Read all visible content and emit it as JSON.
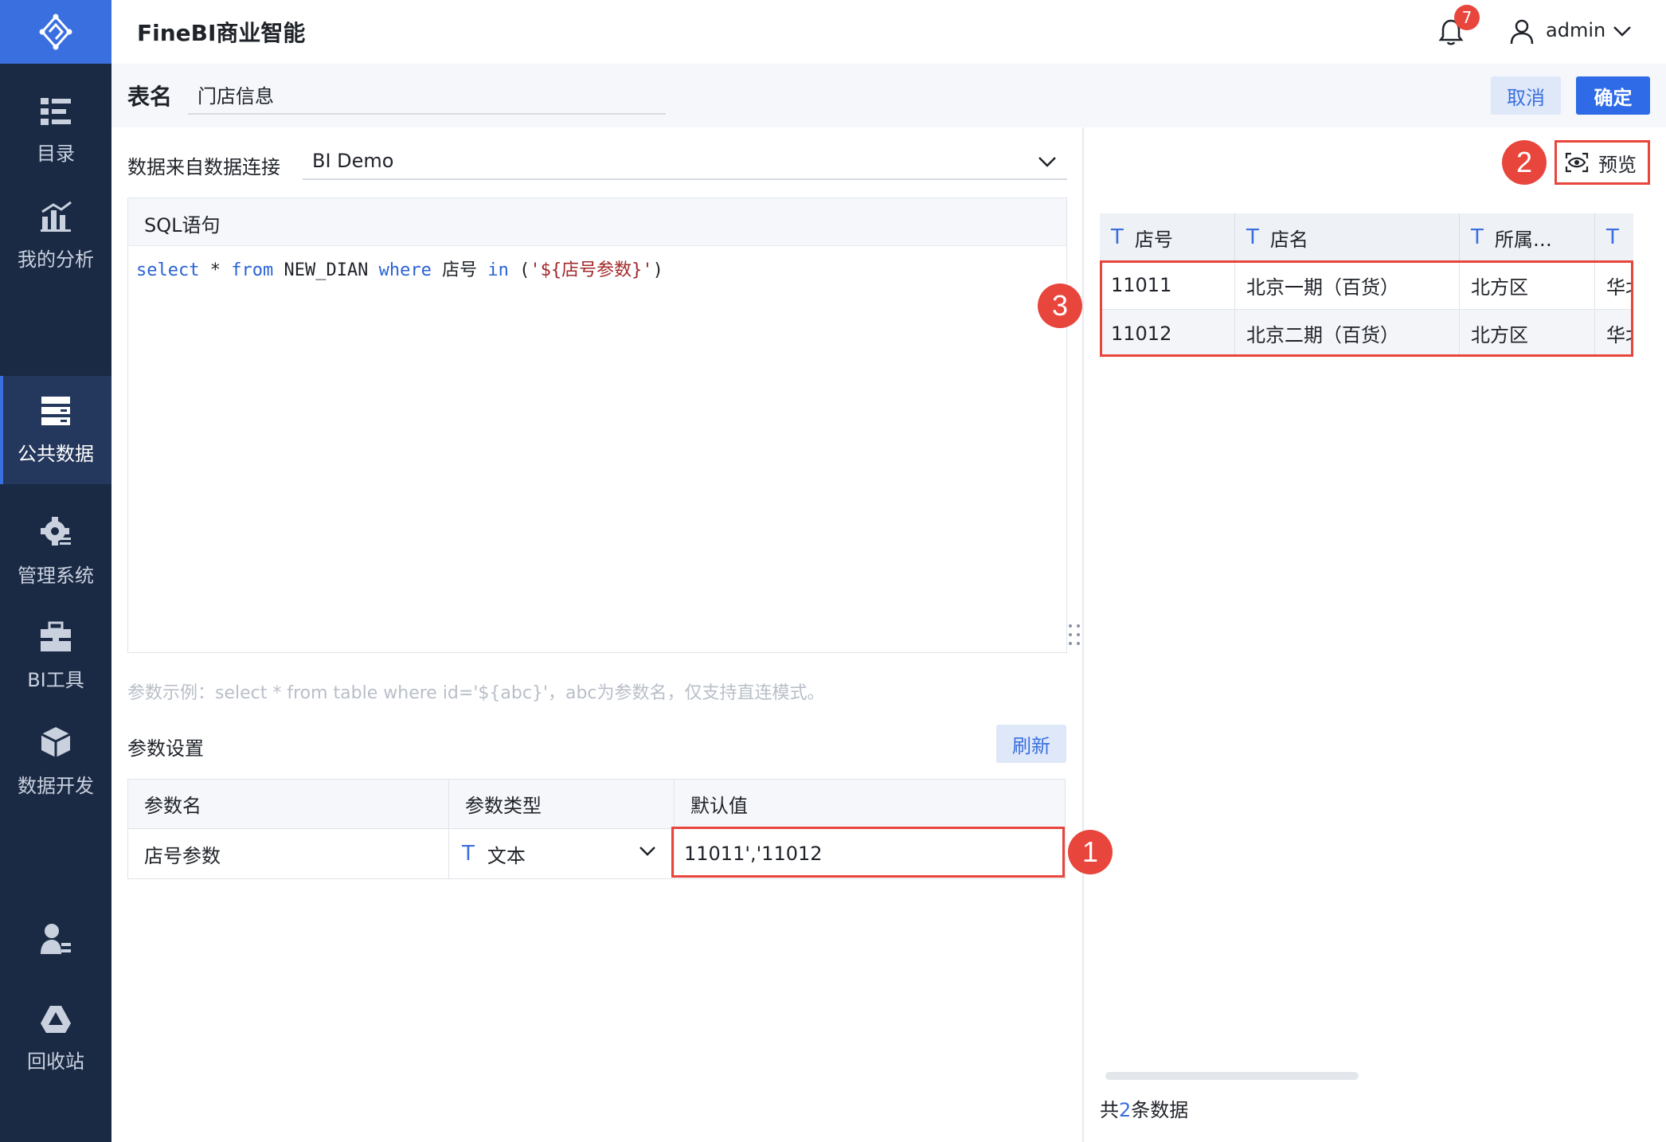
{
  "app": {
    "title": "FineBI商业智能"
  },
  "topbar": {
    "notification_count": "7",
    "user_name": "admin"
  },
  "sidebar": {
    "items": [
      {
        "label": "目录",
        "icon": "catalog-icon"
      },
      {
        "label": "我的分析",
        "icon": "analysis-icon"
      },
      {
        "label": "公共数据",
        "icon": "public-data-icon",
        "active": true
      },
      {
        "label": "管理系统",
        "icon": "settings-gear-icon"
      },
      {
        "label": "BI工具",
        "icon": "toolbox-icon"
      },
      {
        "label": "数据开发",
        "icon": "cube-icon"
      },
      {
        "label": "",
        "icon": "user-manage-icon"
      },
      {
        "label": "回收站",
        "icon": "recycle-icon"
      }
    ]
  },
  "header": {
    "table_name_label": "表名",
    "table_name_value": "门店信息",
    "cancel_label": "取消",
    "confirm_label": "确定"
  },
  "source": {
    "label": "数据来自数据连接",
    "value": "BI Demo"
  },
  "sql": {
    "title": "SQL语句",
    "tokens": {
      "t1": "select",
      "t2": " * ",
      "t3": "from",
      "t4": " NEW_DIAN ",
      "t5": "where",
      "t6": " 店号 ",
      "t7": "in",
      "t8": " (",
      "t9": "'${店号参数}'",
      "t10": ")"
    }
  },
  "hint": "参数示例：select * from table where id='${abc}'，abc为参数名，仅支持直连模式。",
  "params": {
    "label": "参数设置",
    "refresh_label": "刷新",
    "headers": [
      "参数名",
      "参数类型",
      "默认值"
    ],
    "row": {
      "name": "店号参数",
      "type": "文本",
      "default": "11011','11012"
    }
  },
  "preview": {
    "button_label": "预览",
    "columns": [
      "店号",
      "店名",
      "所属…",
      ""
    ],
    "rows": [
      [
        "11011",
        "北京一期（百货）",
        "北方区",
        "华北"
      ],
      [
        "11012",
        "北京二期（百货）",
        "北方区",
        "华北"
      ]
    ],
    "count_prefix": "共",
    "count": "2",
    "count_suffix": "条数据"
  },
  "annotations": {
    "a1": "1",
    "a2": "2",
    "a3": "3"
  },
  "colors": {
    "sidebar": "#1b2a44",
    "accent": "#3a6fe0",
    "annotation": "#e8453c"
  }
}
